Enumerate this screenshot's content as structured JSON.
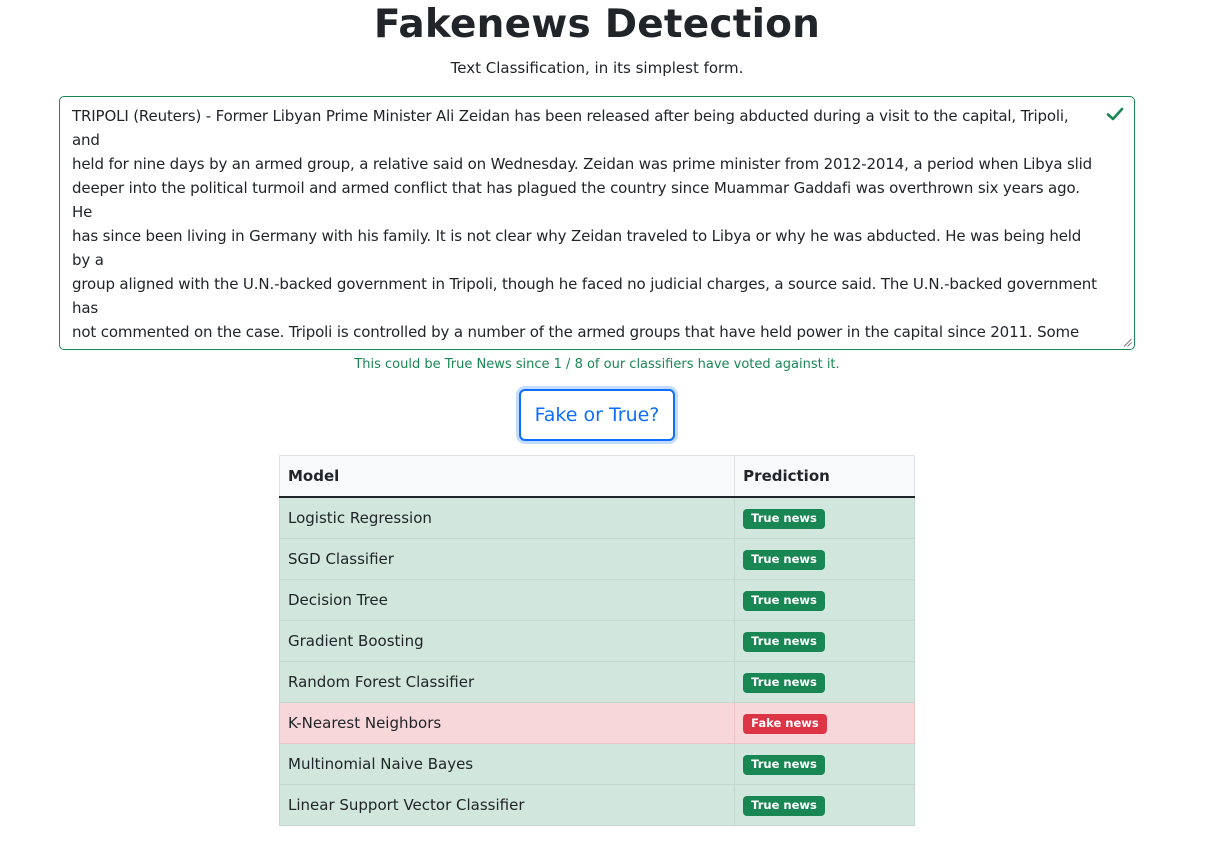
{
  "header": {
    "title": "Fakenews Detection",
    "subtitle": "Text Classification, in its simplest form."
  },
  "input": {
    "article_text": "TRIPOLI (Reuters) - Former Libyan Prime Minister Ali Zeidan has been released after being abducted during a visit to the capital, Tripoli, and\nheld for nine days by an armed group, a relative said on Wednesday. Zeidan was prime minister from 2012-2014, a period when Libya slid\ndeeper into the political turmoil and armed conflict that has plagued the country since Muammar Gaddafi was overthrown six years ago.  He\nhas since been living in Germany with his family. It is not clear why Zeidan traveled to Libya or why he was abducted. He was being held by a\ngroup aligned with the U.N.-backed government in Tripoli, though he faced no judicial charges, a source said. The U.N.-backed government has\nnot commented on the case. Tripoli is controlled by a number of the armed groups that have held power in the capital since 2011. Some have\nbeen given semi-official status by successive governments, but the groups remain unaccountable and involved in criminal activity. A lawyer for\nZeidan, Moussa Al-Doghali, told France 24 Arabic TV channel that his client was released without explanation and that he did not know the\ncircumstances of his arrest and detention. Zeidan was in good health and was staying in a Tripoli hotel following his release, Doghali said.   In\nOctober 2013, Zeidan was briefly abducted from a Tripoli hotel room by an armed group allied to the parliament that sacked him just over a",
    "validation_message": "This could be True News since 1 / 8 of our classifiers have voted against it.",
    "validation_state": "valid"
  },
  "actions": {
    "submit_label": "Fake or True?"
  },
  "results": {
    "headers": {
      "model": "Model",
      "prediction": "Prediction"
    },
    "rows": [
      {
        "model": "Logistic Regression",
        "prediction": "True news",
        "status": "true"
      },
      {
        "model": "SGD Classifier",
        "prediction": "True news",
        "status": "true"
      },
      {
        "model": "Decision Tree",
        "prediction": "True news",
        "status": "true"
      },
      {
        "model": "Gradient Boosting",
        "prediction": "True news",
        "status": "true"
      },
      {
        "model": "Random Forest Classifier",
        "prediction": "True news",
        "status": "true"
      },
      {
        "model": "K-Nearest Neighbors",
        "prediction": "Fake news",
        "status": "fake"
      },
      {
        "model": "Multinomial Naive Bayes",
        "prediction": "True news",
        "status": "true"
      },
      {
        "model": "Linear Support Vector Classifier",
        "prediction": "True news",
        "status": "true"
      }
    ]
  },
  "colors": {
    "success": "#198754",
    "danger": "#dc3545",
    "primary": "#0d6efd",
    "success_row": "#d1e7dd",
    "danger_row": "#f8d7da"
  },
  "icons": {
    "valid": "check-icon",
    "resize": "resize-grip-icon"
  }
}
